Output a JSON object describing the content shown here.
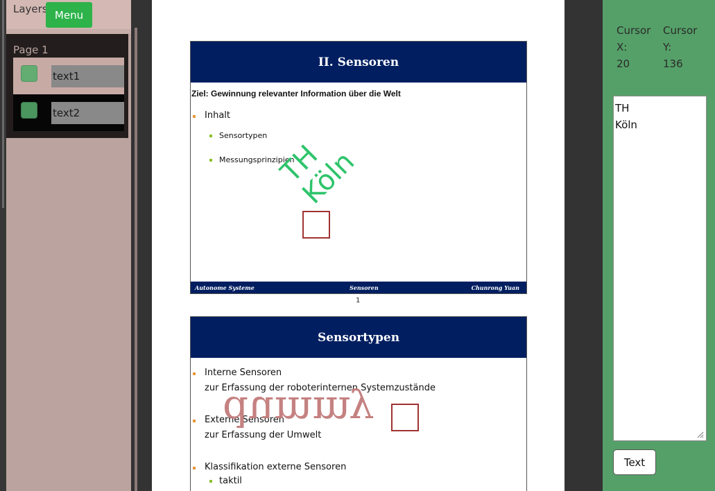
{
  "layers_panel": {
    "title": "Layers",
    "menu_label": "Menu",
    "page_label": "Page 1",
    "layers": [
      {
        "name": "text1"
      },
      {
        "name": "text2"
      }
    ]
  },
  "document": {
    "slide1": {
      "title": "II. Sensoren",
      "subtitle": "Ziel: Gewinnung relevanter Information über die Welt",
      "bullet1": "Inhalt",
      "sub_bullets": [
        "Sensortypen",
        "Messungsprinzipien"
      ],
      "footer_left": "Autonome Systeme",
      "footer_center": "Sensoren",
      "footer_right": "Chunrong Yuan"
    },
    "page_number": "1",
    "slide2": {
      "title": "Sensortypen",
      "bullet1": "Interne Sensoren",
      "bullet1_text": "zur Erfassung der roboterinternen Systemzustände",
      "bullet2": "Externe Sensoren",
      "bullet2_text": "zur Erfassung der Umwelt",
      "bullet3": "Klassifikation externe Sensoren",
      "sub_bullet": "taktil"
    },
    "overlay_text_1": "TH\nKöln",
    "overlay_text_2": "dummy"
  },
  "right_panel": {
    "cursor_x_label": "Cursor X:",
    "cursor_x_value": "20",
    "cursor_y_label": "Cursor Y:",
    "cursor_y_value": "136",
    "text_value": "TH\nKöln",
    "text_button_label": "Text"
  },
  "colors": {
    "menu_button": "#2db34a",
    "right_panel": "#55a068",
    "slide_header": "#001e60",
    "overlay_1": "#2ec46b",
    "overlay_2": "#c27b7b",
    "handle_border": "#a03232"
  }
}
